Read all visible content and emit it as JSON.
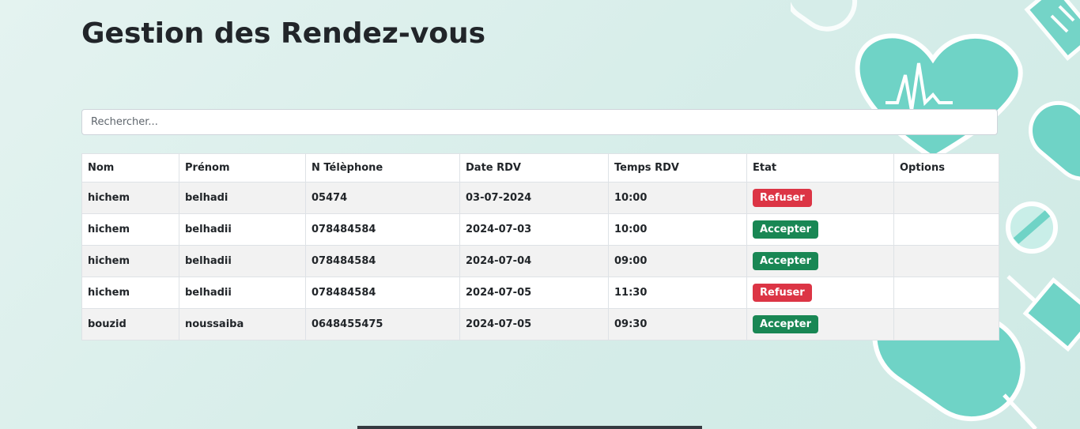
{
  "page": {
    "title": "Gestion des Rendez-vous"
  },
  "search": {
    "placeholder": "Rechercher..."
  },
  "table": {
    "headers": [
      "Nom",
      "Prénom",
      "N Télèphone",
      "Date RDV",
      "Temps RDV",
      "Etat",
      "Options"
    ],
    "rows": [
      {
        "nom": "hichem",
        "prenom": "belhadi",
        "telephone": "05474",
        "date": "03-07-2024",
        "temps": "10:00",
        "etat": "Refuser"
      },
      {
        "nom": "hichem",
        "prenom": "belhadii",
        "telephone": "078484584",
        "date": "2024-07-03",
        "temps": "10:00",
        "etat": "Accepter"
      },
      {
        "nom": "hichem",
        "prenom": "belhadii",
        "telephone": "078484584",
        "date": "2024-07-04",
        "temps": "09:00",
        "etat": "Accepter"
      },
      {
        "nom": "hichem",
        "prenom": "belhadii",
        "telephone": "078484584",
        "date": "2024-07-05",
        "temps": "11:30",
        "etat": "Refuser"
      },
      {
        "nom": "bouzid",
        "prenom": "noussaiba",
        "telephone": "0648455475",
        "date": "2024-07-05",
        "temps": "09:30",
        "etat": "Accepter"
      }
    ]
  },
  "colors": {
    "refuser": "#dc3545",
    "accepter": "#198754",
    "decor_teal": "#6fd3c6"
  },
  "decor": {
    "icons": [
      "heart-pulse-icon",
      "pill-icon",
      "syringe-icon",
      "stethoscope-icon"
    ]
  }
}
